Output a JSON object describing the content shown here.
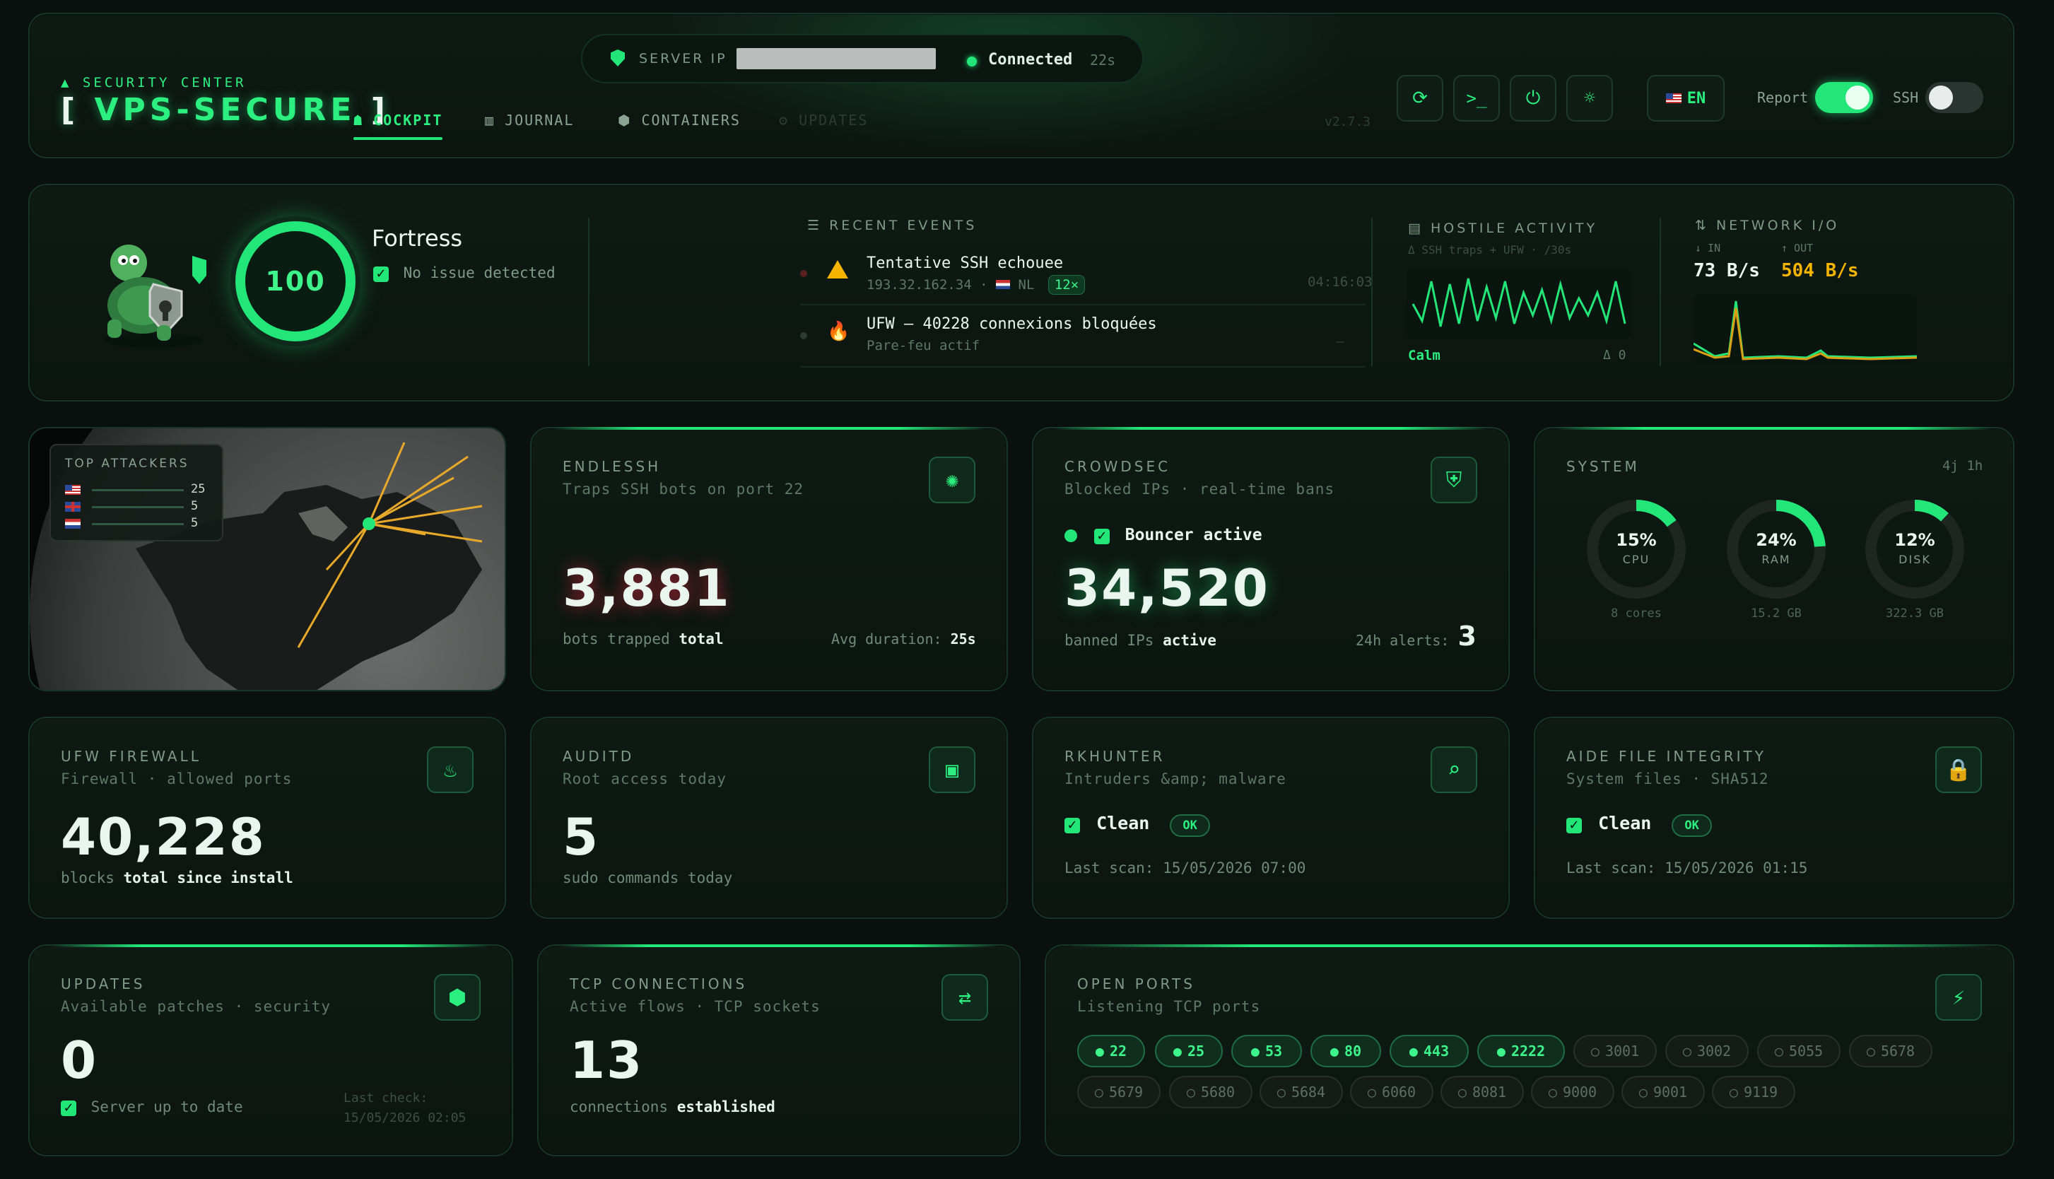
{
  "header": {
    "eyebrow": "SECURITY CENTER",
    "title": "VPS-SECURE",
    "title_bracket_left": "[",
    "title_bracket_right": "]",
    "server_ip_label": "SERVER IP",
    "connection_status": "Connected",
    "connection_age": "22s",
    "version": "v2.7.3",
    "language": "EN",
    "report_label": "Report",
    "report_on": true,
    "ssh_label": "SSH",
    "ssh_on": false,
    "tabs": [
      {
        "label": "COCKPIT",
        "icon": "rocket-icon",
        "active": true
      },
      {
        "label": "JOURNAL",
        "icon": "book-icon",
        "active": false
      },
      {
        "label": "CONTAINERS",
        "icon": "cube-icon",
        "active": false
      },
      {
        "label": "UPDATES",
        "icon": "gear-icon",
        "active": false,
        "disabled": true
      }
    ]
  },
  "status": {
    "score": "100",
    "level": "Fortress",
    "message": "No issue detected"
  },
  "events": {
    "title": "RECENT EVENTS",
    "items": [
      {
        "title": "Tentative SSH echouee",
        "ip": "193.32.162.34",
        "country": "NL",
        "count": "12×",
        "time": "04:16:03",
        "icon": "warning-icon"
      },
      {
        "title": "UFW — 40228 connexions bloquées",
        "detail": "Pare-feu actif",
        "time": "—",
        "icon": "fire-icon"
      }
    ]
  },
  "hostile": {
    "title": "HOSTILE ACTIVITY",
    "subtitle": "Δ SSH traps + UFW · /30s",
    "state": "Calm",
    "delta": "Δ 0",
    "series": [
      0.5,
      0.2,
      0.9,
      0.1,
      0.85,
      0.15,
      0.95,
      0.2,
      0.8,
      0.25,
      0.9,
      0.15,
      0.7,
      0.3,
      0.75,
      0.2,
      0.85,
      0.25,
      0.6,
      0.3,
      0.7,
      0.2,
      0.9,
      0.15
    ]
  },
  "network": {
    "title": "NETWORK I/O",
    "in_label": "↓ IN",
    "out_label": "↑ OUT",
    "in_value": "73 B/s",
    "out_value": "504 B/s"
  },
  "attackers": {
    "title": "TOP ATTACKERS",
    "rows": [
      {
        "flag": "us",
        "count": "25",
        "share": 1.0
      },
      {
        "flag": "gb",
        "count": "5",
        "share": 0.2
      },
      {
        "flag": "nl",
        "count": "5",
        "share": 0.2
      }
    ]
  },
  "endlessh": {
    "title": "ENDLESSH",
    "subtitle": "Traps SSH bots on port 22",
    "value": "3,881",
    "caption_a": "bots trapped",
    "caption_b": "total",
    "avg_label": "Avg duration:",
    "avg_value": "25s"
  },
  "crowdsec": {
    "title": "CROWDSEC",
    "subtitle": "Blocked IPs · real-time bans",
    "bouncer": "Bouncer active",
    "value": "34,520",
    "caption_a": "banned IPs",
    "caption_b": "active",
    "alerts_label": "24h alerts:",
    "alerts_value": "3"
  },
  "system": {
    "title": "SYSTEM",
    "uptime": "4j 1h",
    "gauges": [
      {
        "value": "15%",
        "pct": 15,
        "name": "CPU",
        "detail": "8 cores"
      },
      {
        "value": "24%",
        "pct": 24,
        "name": "RAM",
        "detail": "15.2 GB"
      },
      {
        "value": "12%",
        "pct": 12,
        "name": "DISK",
        "detail": "322.3 GB"
      }
    ]
  },
  "ufw": {
    "title": "UFW FIREWALL",
    "subtitle": "Firewall · allowed ports",
    "value": "40,228",
    "caption_a": "blocks",
    "caption_b": "total since install"
  },
  "auditd": {
    "title": "AUDITD",
    "subtitle": "Root access today",
    "value": "5",
    "caption": "sudo commands today"
  },
  "rkhunter": {
    "title": "RKHUNTER",
    "subtitle": "Intruders &amp; malware",
    "status": "Clean",
    "badge": "OK",
    "last_scan": "Last scan: 15/05/2026 07:00"
  },
  "aide": {
    "title": "AIDE FILE INTEGRITY",
    "subtitle": "System files · SHA512",
    "status": "Clean",
    "badge": "OK",
    "last_scan": "Last scan: 15/05/2026 01:15"
  },
  "updates": {
    "title": "UPDATES",
    "subtitle": "Available patches · security",
    "value": "0",
    "status": "Server up to date",
    "last_check_label": "Last check:",
    "last_check_value": "15/05/2026 02:05"
  },
  "tcp": {
    "title": "TCP CONNECTIONS",
    "subtitle": "Active flows · TCP sockets",
    "value": "13",
    "caption_a": "connections",
    "caption_b": "established"
  },
  "ports": {
    "title": "OPEN PORTS",
    "subtitle": "Listening TCP ports",
    "open": [
      "22",
      "25",
      "53",
      "80",
      "443",
      "2222"
    ],
    "closed": [
      "3001",
      "3002",
      "5055",
      "5678",
      "5679",
      "5680",
      "5684",
      "6060",
      "8081",
      "9000",
      "9001",
      "9119"
    ]
  },
  "colors": {
    "accent": "#22e678",
    "warning": "#f5b400",
    "background": "#0a100d"
  }
}
